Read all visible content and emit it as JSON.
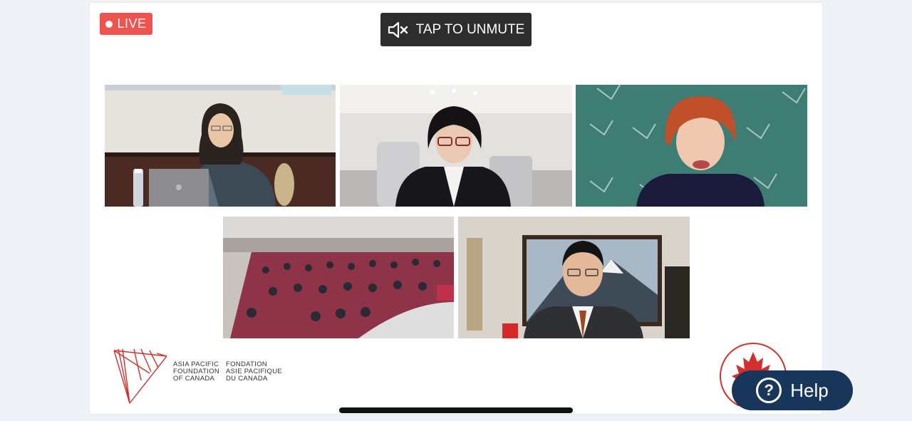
{
  "live_badge": {
    "label": "LIVE",
    "color": "#ef5350"
  },
  "unmute_button": {
    "label": "TAP TO UNMUTE",
    "icon": "speaker-muted-icon"
  },
  "video_tiles": [
    {
      "name": "participant-1"
    },
    {
      "name": "participant-2"
    },
    {
      "name": "participant-3"
    },
    {
      "name": "auditorium-audience"
    },
    {
      "name": "participant-5"
    }
  ],
  "logo": {
    "english": "ASIA PACIFIC\nFOUNDATION\nOF CANADA",
    "french": "FONDATION\nASIE PACIFIQUE\nDU CANADA",
    "color": "#d32f2f"
  },
  "help_button": {
    "label": "Help",
    "icon": "question-icon",
    "color": "#18365a"
  }
}
